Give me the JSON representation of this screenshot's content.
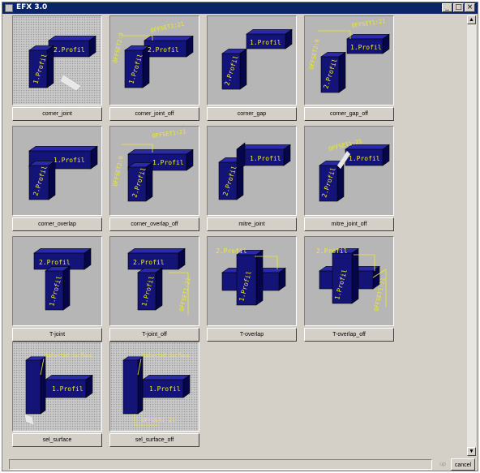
{
  "window": {
    "title": "EFX 3.0",
    "minimize": "_",
    "maximize": "□",
    "close": "×"
  },
  "tiles": [
    {
      "label": "corner_joint",
      "texts": [
        "2.Profil",
        "1.Profil"
      ]
    },
    {
      "label": "corner_joint_off",
      "texts": [
        "2.Profil",
        "1.Profil",
        "OFFSET1:21",
        "OFFSET2:9"
      ]
    },
    {
      "label": "corner_gap",
      "texts": [
        "1.Profil",
        "2.Profil"
      ]
    },
    {
      "label": "corner_gap_off",
      "texts": [
        "1.Profil",
        "2.Profil",
        "OFFSET1:21",
        "OFFSET2:9"
      ]
    },
    {
      "label": "corner_overlap",
      "texts": [
        "1.Profil",
        "2.Profil"
      ]
    },
    {
      "label": "corner_overlap_off",
      "texts": [
        "1.Profil",
        "2.Profil",
        "OFFSET1:21",
        "OFFSET2:9"
      ]
    },
    {
      "label": "mitre_joint",
      "texts": [
        "1.Profil",
        "2.Profil"
      ]
    },
    {
      "label": "mitre_joint_off",
      "texts": [
        "1.Profil",
        "2.Profil",
        "OFFSET1:21"
      ]
    },
    {
      "label": "T-joint",
      "texts": [
        "2.Profil",
        "1.Profil"
      ]
    },
    {
      "label": "T-joint_off",
      "texts": [
        "2.Profil",
        "1.Profil",
        "OFFSET1:21"
      ]
    },
    {
      "label": "T-overlap",
      "texts": [
        "2.Profil",
        "1.Profil"
      ]
    },
    {
      "label": "T-overlap_off",
      "texts": [
        "2.Profil",
        "1.Profil",
        "OFFSET1:21"
      ]
    },
    {
      "label": "sel_surface",
      "texts": [
        "1.Profil",
        "Selected Surface"
      ]
    },
    {
      "label": "sel_surface_off",
      "texts": [
        "1.Profil",
        "Selected Surface",
        "OFFSET1:21"
      ]
    }
  ],
  "scrollbar": {
    "up": "▲",
    "down": "▼"
  },
  "footer": {
    "up_label": "up",
    "cancel_label": "cancel"
  },
  "colors": {
    "profile_fill": "#141478",
    "profile_dark": "#05054a",
    "profile_top": "#2a2aa8",
    "annotation": "#f0e830"
  }
}
